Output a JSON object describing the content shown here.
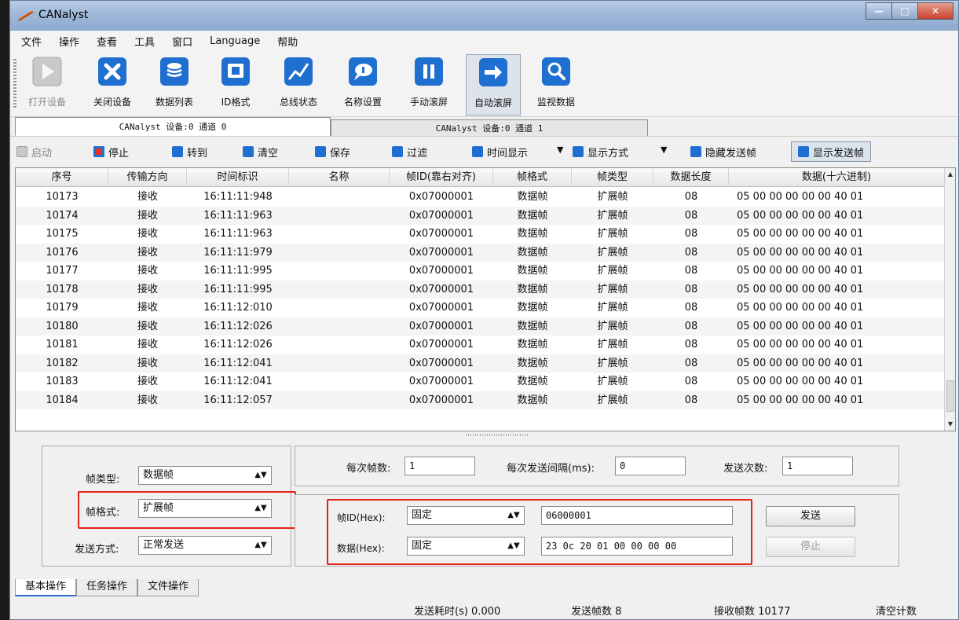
{
  "window": {
    "title": "CANalyst",
    "min_label": "—",
    "max_label": "□",
    "close_label": "✕"
  },
  "menu": [
    "文件",
    "操作",
    "查看",
    "工具",
    "窗口",
    "Language",
    "帮助"
  ],
  "toolbar": [
    {
      "label": "打开设备",
      "icon": "play-icon",
      "disabled": true
    },
    {
      "label": "关闭设备",
      "icon": "close-device-icon"
    },
    {
      "label": "数据列表",
      "icon": "database-icon"
    },
    {
      "label": "ID格式",
      "icon": "id-format-icon"
    },
    {
      "label": "总线状态",
      "icon": "bus-status-icon"
    },
    {
      "label": "名称设置",
      "icon": "name-settings-icon"
    },
    {
      "label": "手动滚屏",
      "icon": "pause-icon"
    },
    {
      "label": "自动滚屏",
      "icon": "auto-scroll-icon",
      "pressed": true
    },
    {
      "label": "监视数据",
      "icon": "magnifier-icon"
    }
  ],
  "channel_tabs": [
    "CANalyst 设备:0 通道 0",
    "CANalyst 设备:0 通道 1"
  ],
  "controls": {
    "start": "启动",
    "stop": "停止",
    "goto": "转到",
    "clear": "清空",
    "save": "保存",
    "filter": "过滤",
    "time_display": "时间显示",
    "display_mode": "显示方式",
    "hide_send": "隐藏发送帧",
    "show_send": "显示发送帧"
  },
  "table": {
    "headers": [
      "序号",
      "传输方向",
      "时间标识",
      "名称",
      "帧ID(靠右对齐)",
      "帧格式",
      "帧类型",
      "数据长度",
      "数据(十六进制)"
    ],
    "rows": [
      [
        "10173",
        "接收",
        "16:11:11:948",
        "",
        "0x07000001",
        "数据帧",
        "扩展帧",
        "08",
        "05 00 00 00 00 00 40 01"
      ],
      [
        "10174",
        "接收",
        "16:11:11:963",
        "",
        "0x07000001",
        "数据帧",
        "扩展帧",
        "08",
        "05 00 00 00 00 00 40 01"
      ],
      [
        "10175",
        "接收",
        "16:11:11:963",
        "",
        "0x07000001",
        "数据帧",
        "扩展帧",
        "08",
        "05 00 00 00 00 00 40 01"
      ],
      [
        "10176",
        "接收",
        "16:11:11:979",
        "",
        "0x07000001",
        "数据帧",
        "扩展帧",
        "08",
        "05 00 00 00 00 00 40 01"
      ],
      [
        "10177",
        "接收",
        "16:11:11:995",
        "",
        "0x07000001",
        "数据帧",
        "扩展帧",
        "08",
        "05 00 00 00 00 00 40 01"
      ],
      [
        "10178",
        "接收",
        "16:11:11:995",
        "",
        "0x07000001",
        "数据帧",
        "扩展帧",
        "08",
        "05 00 00 00 00 00 40 01"
      ],
      [
        "10179",
        "接收",
        "16:11:12:010",
        "",
        "0x07000001",
        "数据帧",
        "扩展帧",
        "08",
        "05 00 00 00 00 00 40 01"
      ],
      [
        "10180",
        "接收",
        "16:11:12:026",
        "",
        "0x07000001",
        "数据帧",
        "扩展帧",
        "08",
        "05 00 00 00 00 00 40 01"
      ],
      [
        "10181",
        "接收",
        "16:11:12:026",
        "",
        "0x07000001",
        "数据帧",
        "扩展帧",
        "08",
        "05 00 00 00 00 00 40 01"
      ],
      [
        "10182",
        "接收",
        "16:11:12:041",
        "",
        "0x07000001",
        "数据帧",
        "扩展帧",
        "08",
        "05 00 00 00 00 00 40 01"
      ],
      [
        "10183",
        "接收",
        "16:11:12:041",
        "",
        "0x07000001",
        "数据帧",
        "扩展帧",
        "08",
        "05 00 00 00 00 00 40 01"
      ],
      [
        "10184",
        "接收",
        "16:11:12:057",
        "",
        "0x07000001",
        "数据帧",
        "扩展帧",
        "08",
        "05 00 00 00 00 00 40 01"
      ]
    ]
  },
  "send": {
    "frame_type_label": "帧类型:",
    "frame_type_value": "数据帧",
    "frame_format_label": "帧格式:",
    "frame_format_value": "扩展帧",
    "send_mode_label": "发送方式:",
    "send_mode_value": "正常发送",
    "frames_per_label": "每次帧数:",
    "frames_per_value": "1",
    "interval_label": "每次发送间隔(ms):",
    "interval_value": "0",
    "send_count_label": "发送次数:",
    "send_count_value": "1",
    "frame_id_label": "帧ID(Hex):",
    "frame_id_mode": "固定",
    "frame_id_value": "06000001",
    "data_label": "数据(Hex):",
    "data_mode": "固定",
    "data_value": "23 0c 20 01 00 00 00 00",
    "send_button": "发送",
    "stop_button": "停止"
  },
  "bottom_tabs": [
    "基本操作",
    "任务操作",
    "文件操作"
  ],
  "status": {
    "send_time": "发送耗时(s) 0.000",
    "send_frames": "发送帧数 8",
    "recv_frames": "接收帧数 10177",
    "clear_count": "清空计数"
  },
  "colors": {
    "highlight_red": "#e2231a",
    "icon_blue": "#1f6fd1"
  }
}
